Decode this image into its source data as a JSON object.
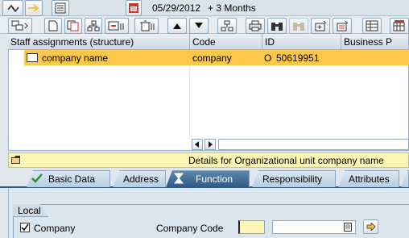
{
  "toolbar_top": {
    "date_value": "05/29/2012",
    "period_label": "+ 3 Months"
  },
  "grid": {
    "columns": [
      "Staff assignments (structure)",
      "Code",
      "ID",
      "Business P"
    ],
    "rows": [
      {
        "name": "company name",
        "code": "company",
        "id_type": "O",
        "id": "50619951"
      }
    ]
  },
  "details_bar": {
    "text": "Details for Organizational unit company name"
  },
  "tabs": [
    {
      "label": "Basic Data"
    },
    {
      "label": "Address"
    },
    {
      "label": "Function"
    },
    {
      "label": "Responsibility"
    },
    {
      "label": "Attributes"
    }
  ],
  "active_tab": "Function",
  "function_tab": {
    "group_title": "Local",
    "company_checkbox_label": "Company",
    "company_checked": true,
    "company_code_label": "Company Code",
    "company_code_value": "",
    "company_code_desc": ""
  },
  "colors": {
    "selection": "#fdc74a",
    "active_tab": "#2f5a84",
    "required_field": "#fdf5b4"
  }
}
